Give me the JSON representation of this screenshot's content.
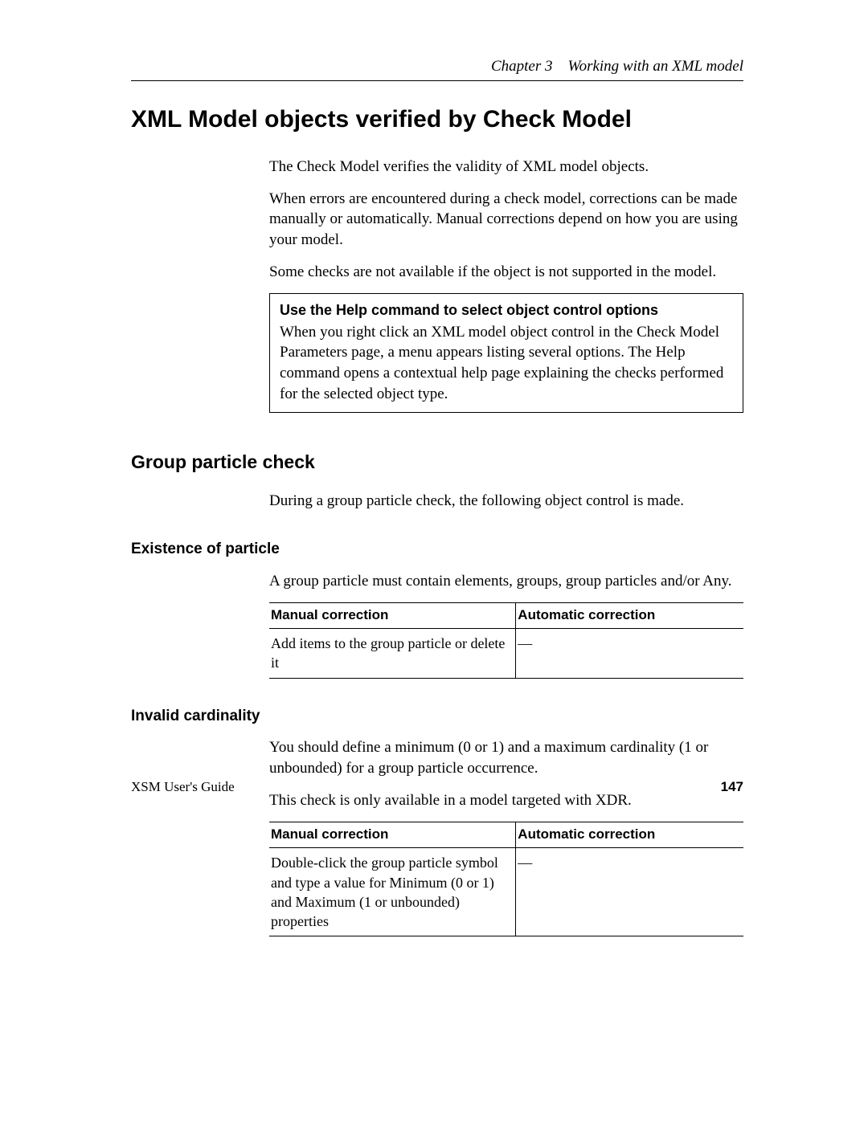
{
  "header": {
    "chapter": "Chapter 3 Working with an XML model"
  },
  "title": "XML Model objects verified by Check Model",
  "intro": {
    "p1": "The Check Model verifies the validity of XML model objects.",
    "p2": "When errors are encountered during a check model, corrections can be made manually or automatically. Manual corrections depend on how you are using your model.",
    "p3": "Some checks are not available if the object is not supported in the model."
  },
  "note": {
    "title": "Use the Help command to select object control options",
    "body": "When you right click an XML model object control in the Check Model Parameters page, a menu appears listing several options. The Help command opens a contextual help page explaining the checks performed for the selected object type."
  },
  "section1": {
    "heading": "Group particle check",
    "intro": "During a group particle check, the following object control is made."
  },
  "sub1": {
    "heading": "Existence of particle",
    "intro": "A group particle must contain elements, groups, group particles and/or Any.",
    "table": {
      "h1": "Manual correction",
      "h2": "Automatic correction",
      "c1": "Add items to the group particle or delete it",
      "c2": "—"
    }
  },
  "sub2": {
    "heading": "Invalid cardinality",
    "p1": "You should define a minimum (0 or 1) and a maximum cardinality (1 or unbounded) for a group particle occurrence.",
    "p2": "This check is only available in a model targeted with XDR.",
    "table": {
      "h1": "Manual correction",
      "h2": "Automatic correction",
      "c1": "Double-click the group particle symbol and type a value for Minimum (0 or 1) and Maximum (1 or unbounded) properties",
      "c2": "—"
    }
  },
  "footer": {
    "guide": "XSM User's Guide",
    "page": "147"
  }
}
